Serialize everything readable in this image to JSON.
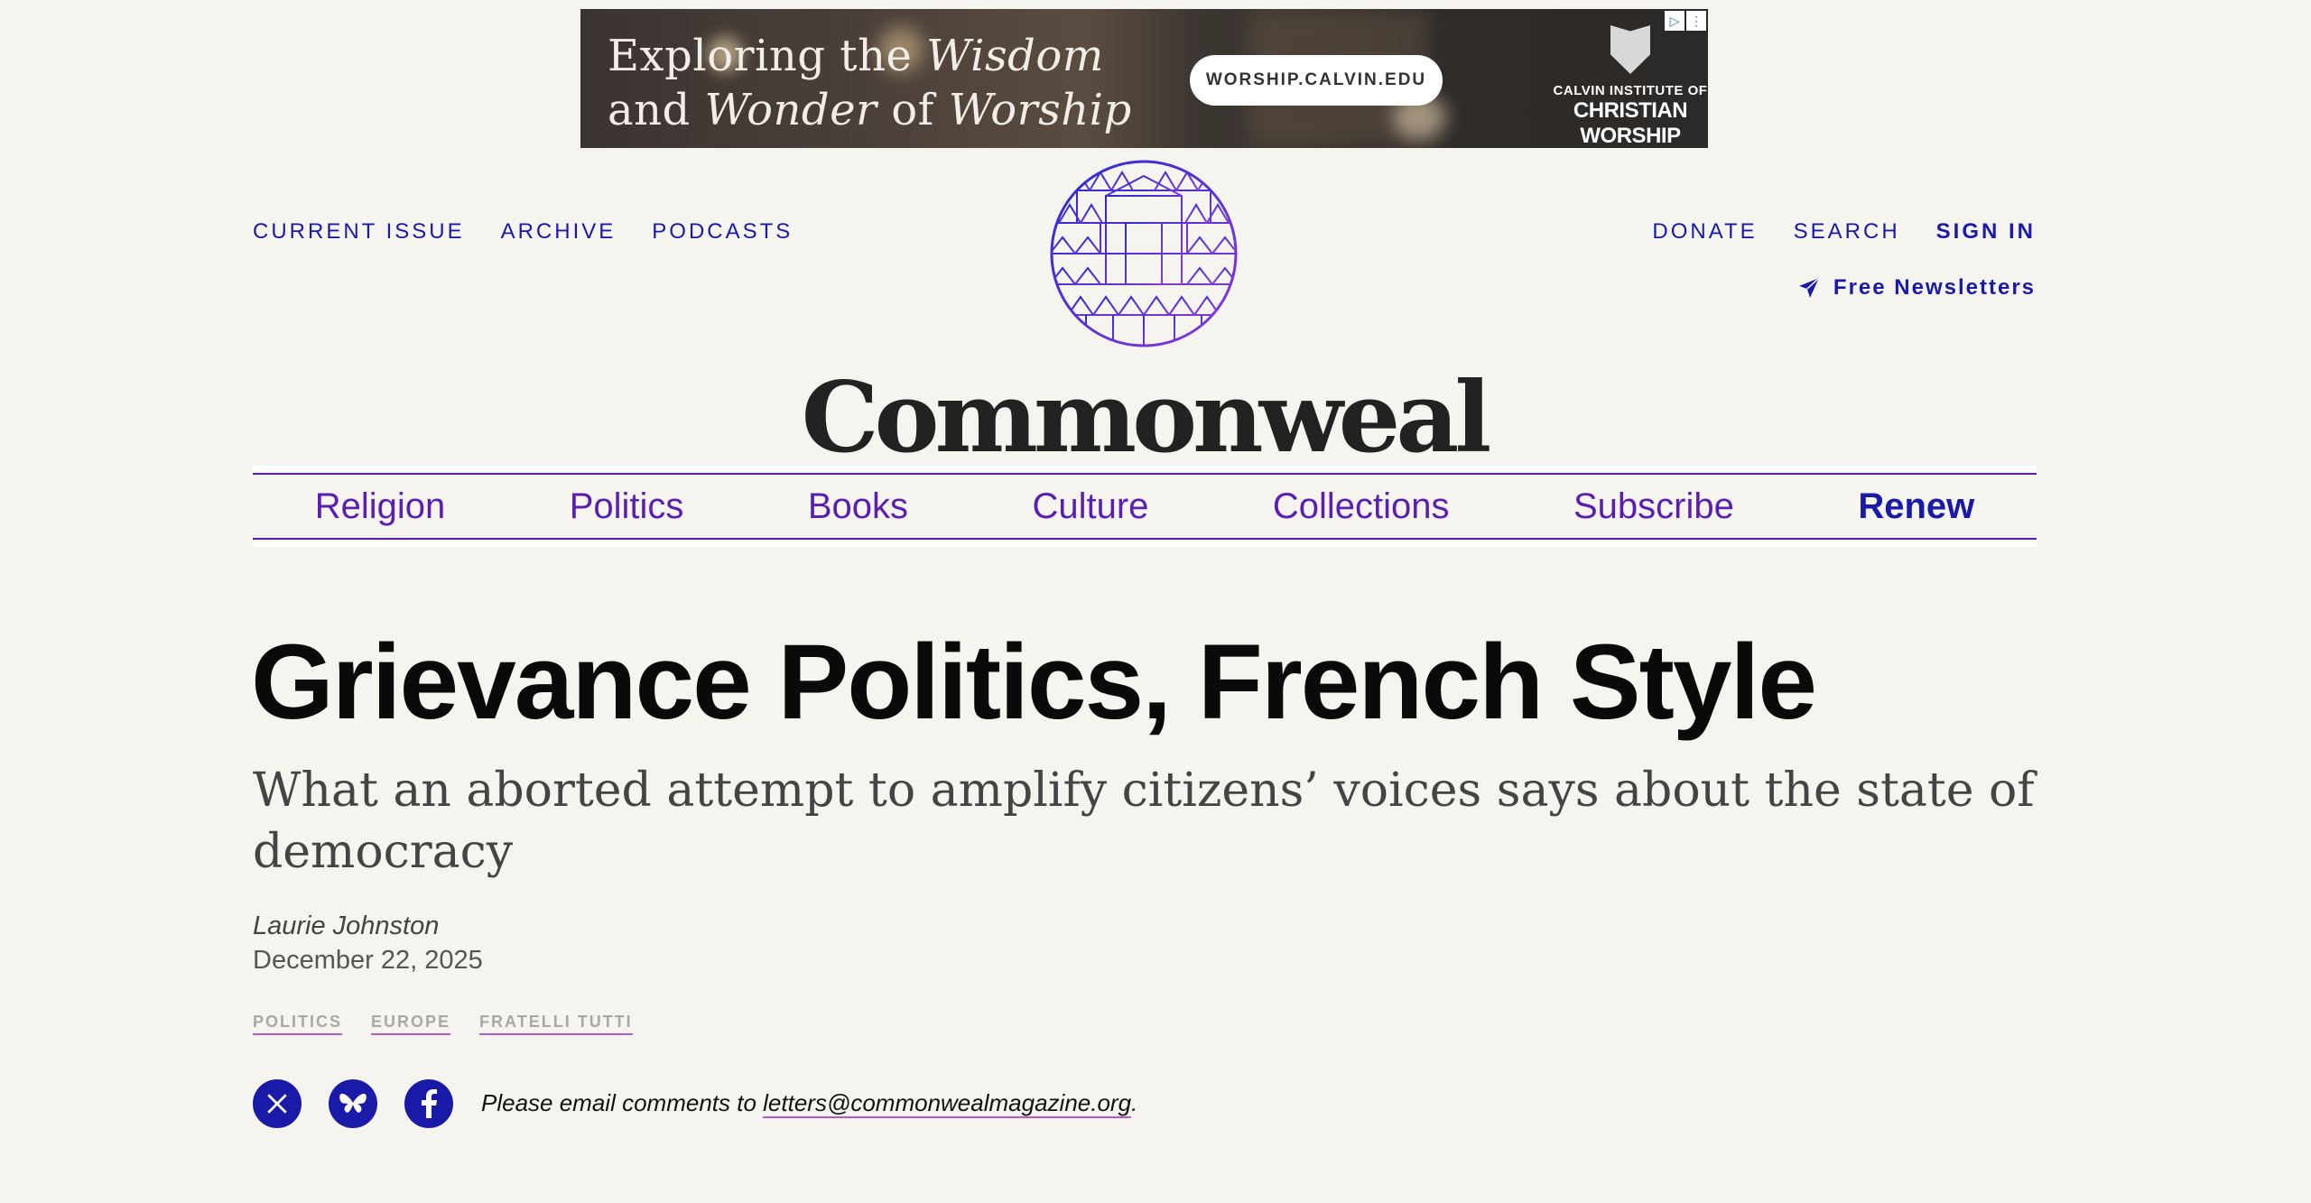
{
  "ad": {
    "headline_line1_pre": "Exploring the ",
    "headline_line1_em": "Wisdom",
    "headline_line2_pre": "and ",
    "headline_line2_em": "Wonder",
    "headline_line2_mid": " of ",
    "headline_line2_em2": "Worship",
    "url": "WORSHIP.CALVIN.EDU",
    "brand_line1": "CALVIN INSTITUTE OF",
    "brand_line2": "CHRISTIAN WORSHIP"
  },
  "header": {
    "left_links": [
      "CURRENT ISSUE",
      "ARCHIVE",
      "PODCASTS"
    ],
    "right_links": [
      "DONATE",
      "SEARCH",
      "SIGN IN"
    ],
    "newsletter": "Free Newsletters",
    "wordmark": "Commonweal"
  },
  "sections": [
    "Religion",
    "Politics",
    "Books",
    "Culture",
    "Collections",
    "Subscribe",
    "Renew"
  ],
  "article": {
    "title": "Grievance Politics, French Style",
    "subtitle": "What an aborted attempt to amplify citizens’ voices says about the state of democracy",
    "author": "Laurie Johnston",
    "date": "December 22, 2025",
    "tags": [
      "POLITICS",
      "EUROPE",
      "FRATELLI TUTTI"
    ],
    "comment_prefix": "Please email comments to ",
    "comment_email": "letters@commonwealmagazine.org",
    "comment_suffix": "."
  },
  "colors": {
    "link": "#1a1aa8",
    "section": "#5a1fb0",
    "tag_underline": "#b15dc7",
    "background": "#f5f4ef"
  },
  "icons": [
    "send-icon",
    "x-icon",
    "bluesky-icon",
    "facebook-icon",
    "adchoices-icon"
  ]
}
